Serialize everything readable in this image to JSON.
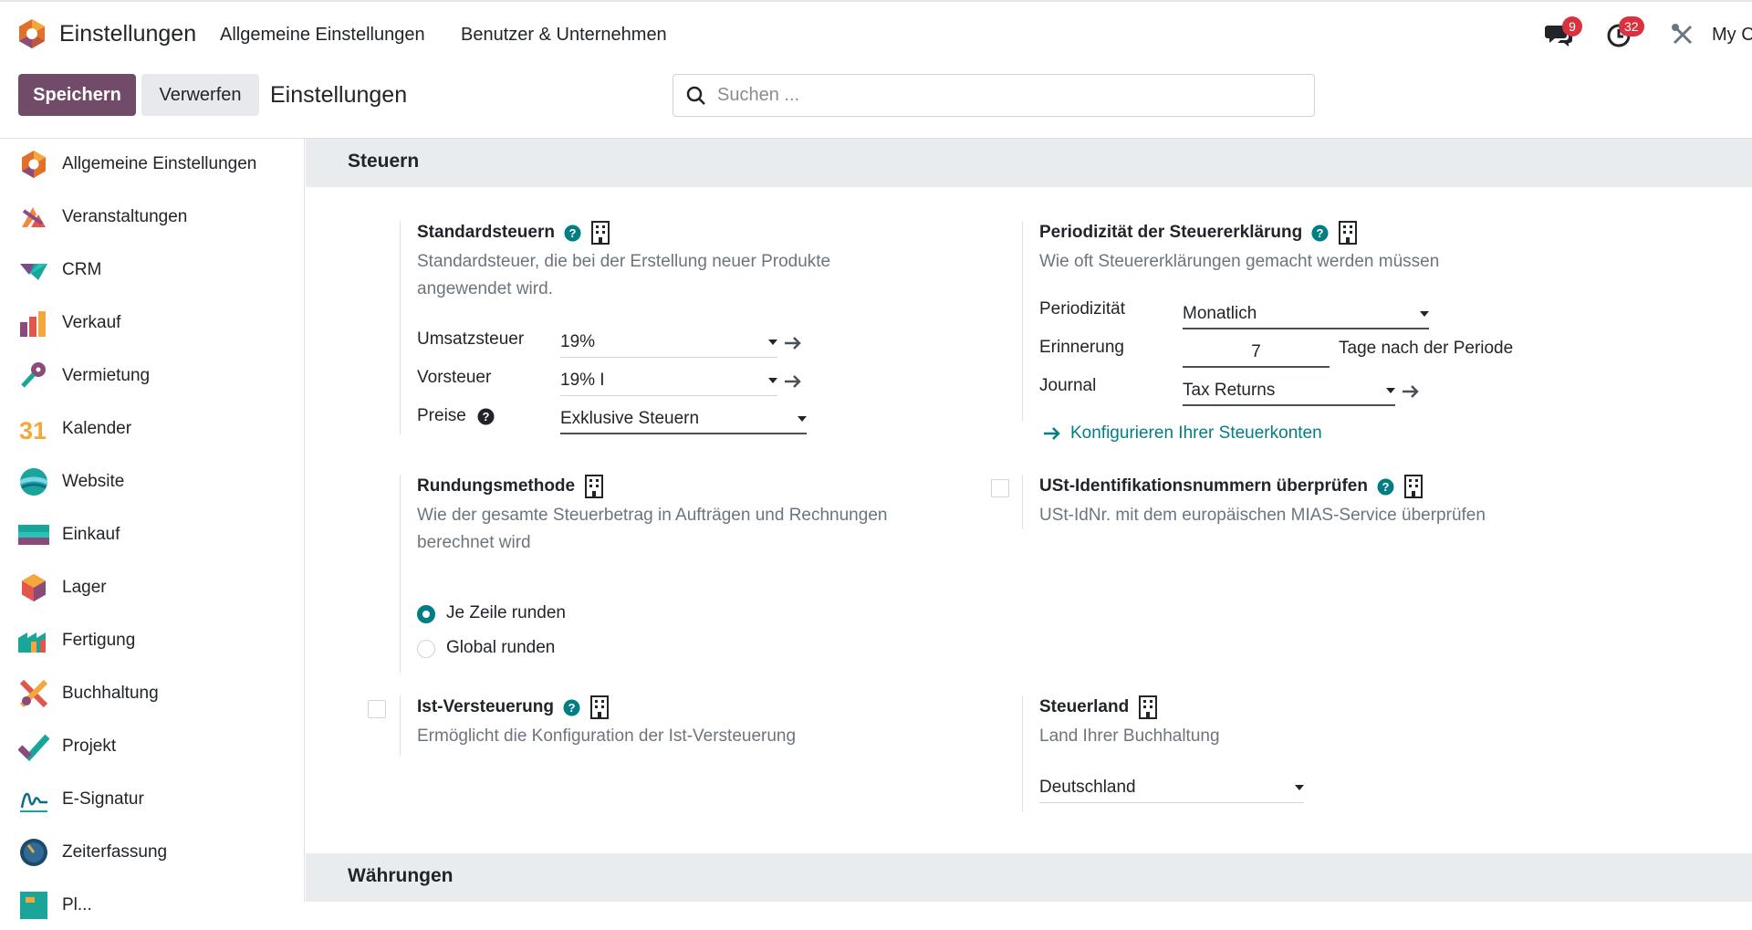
{
  "app": {
    "title": "Einstellungen",
    "brand_color": "#714b67",
    "accent_color": "#017e84"
  },
  "topnav": {
    "items": [
      "Allgemeine Einstellungen",
      "Benutzer & Unternehmen"
    ]
  },
  "systray": {
    "messages_count": "9",
    "activities_count": "32",
    "company": "My C"
  },
  "control": {
    "save": "Speichern",
    "discard": "Verwerfen",
    "breadcrumb": "Einstellungen",
    "search_placeholder": "Suchen ..."
  },
  "sidebar": {
    "items": [
      {
        "label": "Allgemeine Einstellungen",
        "icon": "settings-app-icon"
      },
      {
        "label": "Veranstaltungen",
        "icon": "events-app-icon"
      },
      {
        "label": "CRM",
        "icon": "crm-app-icon"
      },
      {
        "label": "Verkauf",
        "icon": "sales-app-icon"
      },
      {
        "label": "Vermietung",
        "icon": "rental-app-icon"
      },
      {
        "label": "Kalender",
        "icon": "calendar-app-icon"
      },
      {
        "label": "Website",
        "icon": "website-app-icon"
      },
      {
        "label": "Einkauf",
        "icon": "purchase-app-icon"
      },
      {
        "label": "Lager",
        "icon": "inventory-app-icon"
      },
      {
        "label": "Fertigung",
        "icon": "manufacturing-app-icon"
      },
      {
        "label": "Buchhaltung",
        "icon": "accounting-app-icon"
      },
      {
        "label": "Projekt",
        "icon": "project-app-icon"
      },
      {
        "label": "E-Signatur",
        "icon": "sign-app-icon"
      },
      {
        "label": "Zeiterfassung",
        "icon": "timesheet-app-icon"
      },
      {
        "label": "Pl...",
        "icon": "planning-app-icon"
      }
    ]
  },
  "calendar_icon_text": "31",
  "taxes": {
    "section": "Steuern",
    "default_taxes": {
      "title": "Standardsteuern",
      "desc_line1": "Standardsteuer, die bei der Erstellung neuer Produkte",
      "desc_line2": "angewendet wird.",
      "sales_label": "Umsatzsteuer",
      "sales_value": "19%",
      "purchase_label": "Vorsteuer",
      "purchase_value": "19% I",
      "prices_label": "Preise",
      "prices_value": "Exklusive Steuern"
    },
    "periodicity": {
      "title": "Periodizität der Steuererklärung",
      "desc": "Wie oft Steuererklärungen gemacht werden müssen",
      "periodicity_label": "Periodizität",
      "periodicity_value": "Monatlich",
      "reminder_label": "Erinnerung",
      "reminder_value": "7",
      "reminder_suffix": "Tage nach der Periode",
      "journal_label": "Journal",
      "journal_value": "Tax Returns",
      "configure_link": "Konfigurieren Ihrer Steuerkonten"
    },
    "rounding": {
      "title": "Rundungsmethode",
      "desc_line1": "Wie der gesamte Steuerbetrag in Aufträgen und Rechnungen",
      "desc_line2": "berechnet wird",
      "option_line": "Je Zeile runden",
      "option_global": "Global runden",
      "selected": "Je Zeile runden"
    },
    "vat_check": {
      "title": "USt-Identifikationsnummern überprüfen",
      "desc": "USt-IdNr. mit dem europäischen MIAS-Service überprüfen",
      "checked": false
    },
    "cash_basis": {
      "title": "Ist-Versteuerung",
      "desc": "Ermöglicht die Konfiguration der Ist-Versteuerung",
      "checked": false
    },
    "fiscal_country": {
      "title": "Steuerland",
      "desc": "Land Ihrer Buchhaltung",
      "value": "Deutschland"
    }
  },
  "currencies": {
    "section": "Währungen"
  }
}
